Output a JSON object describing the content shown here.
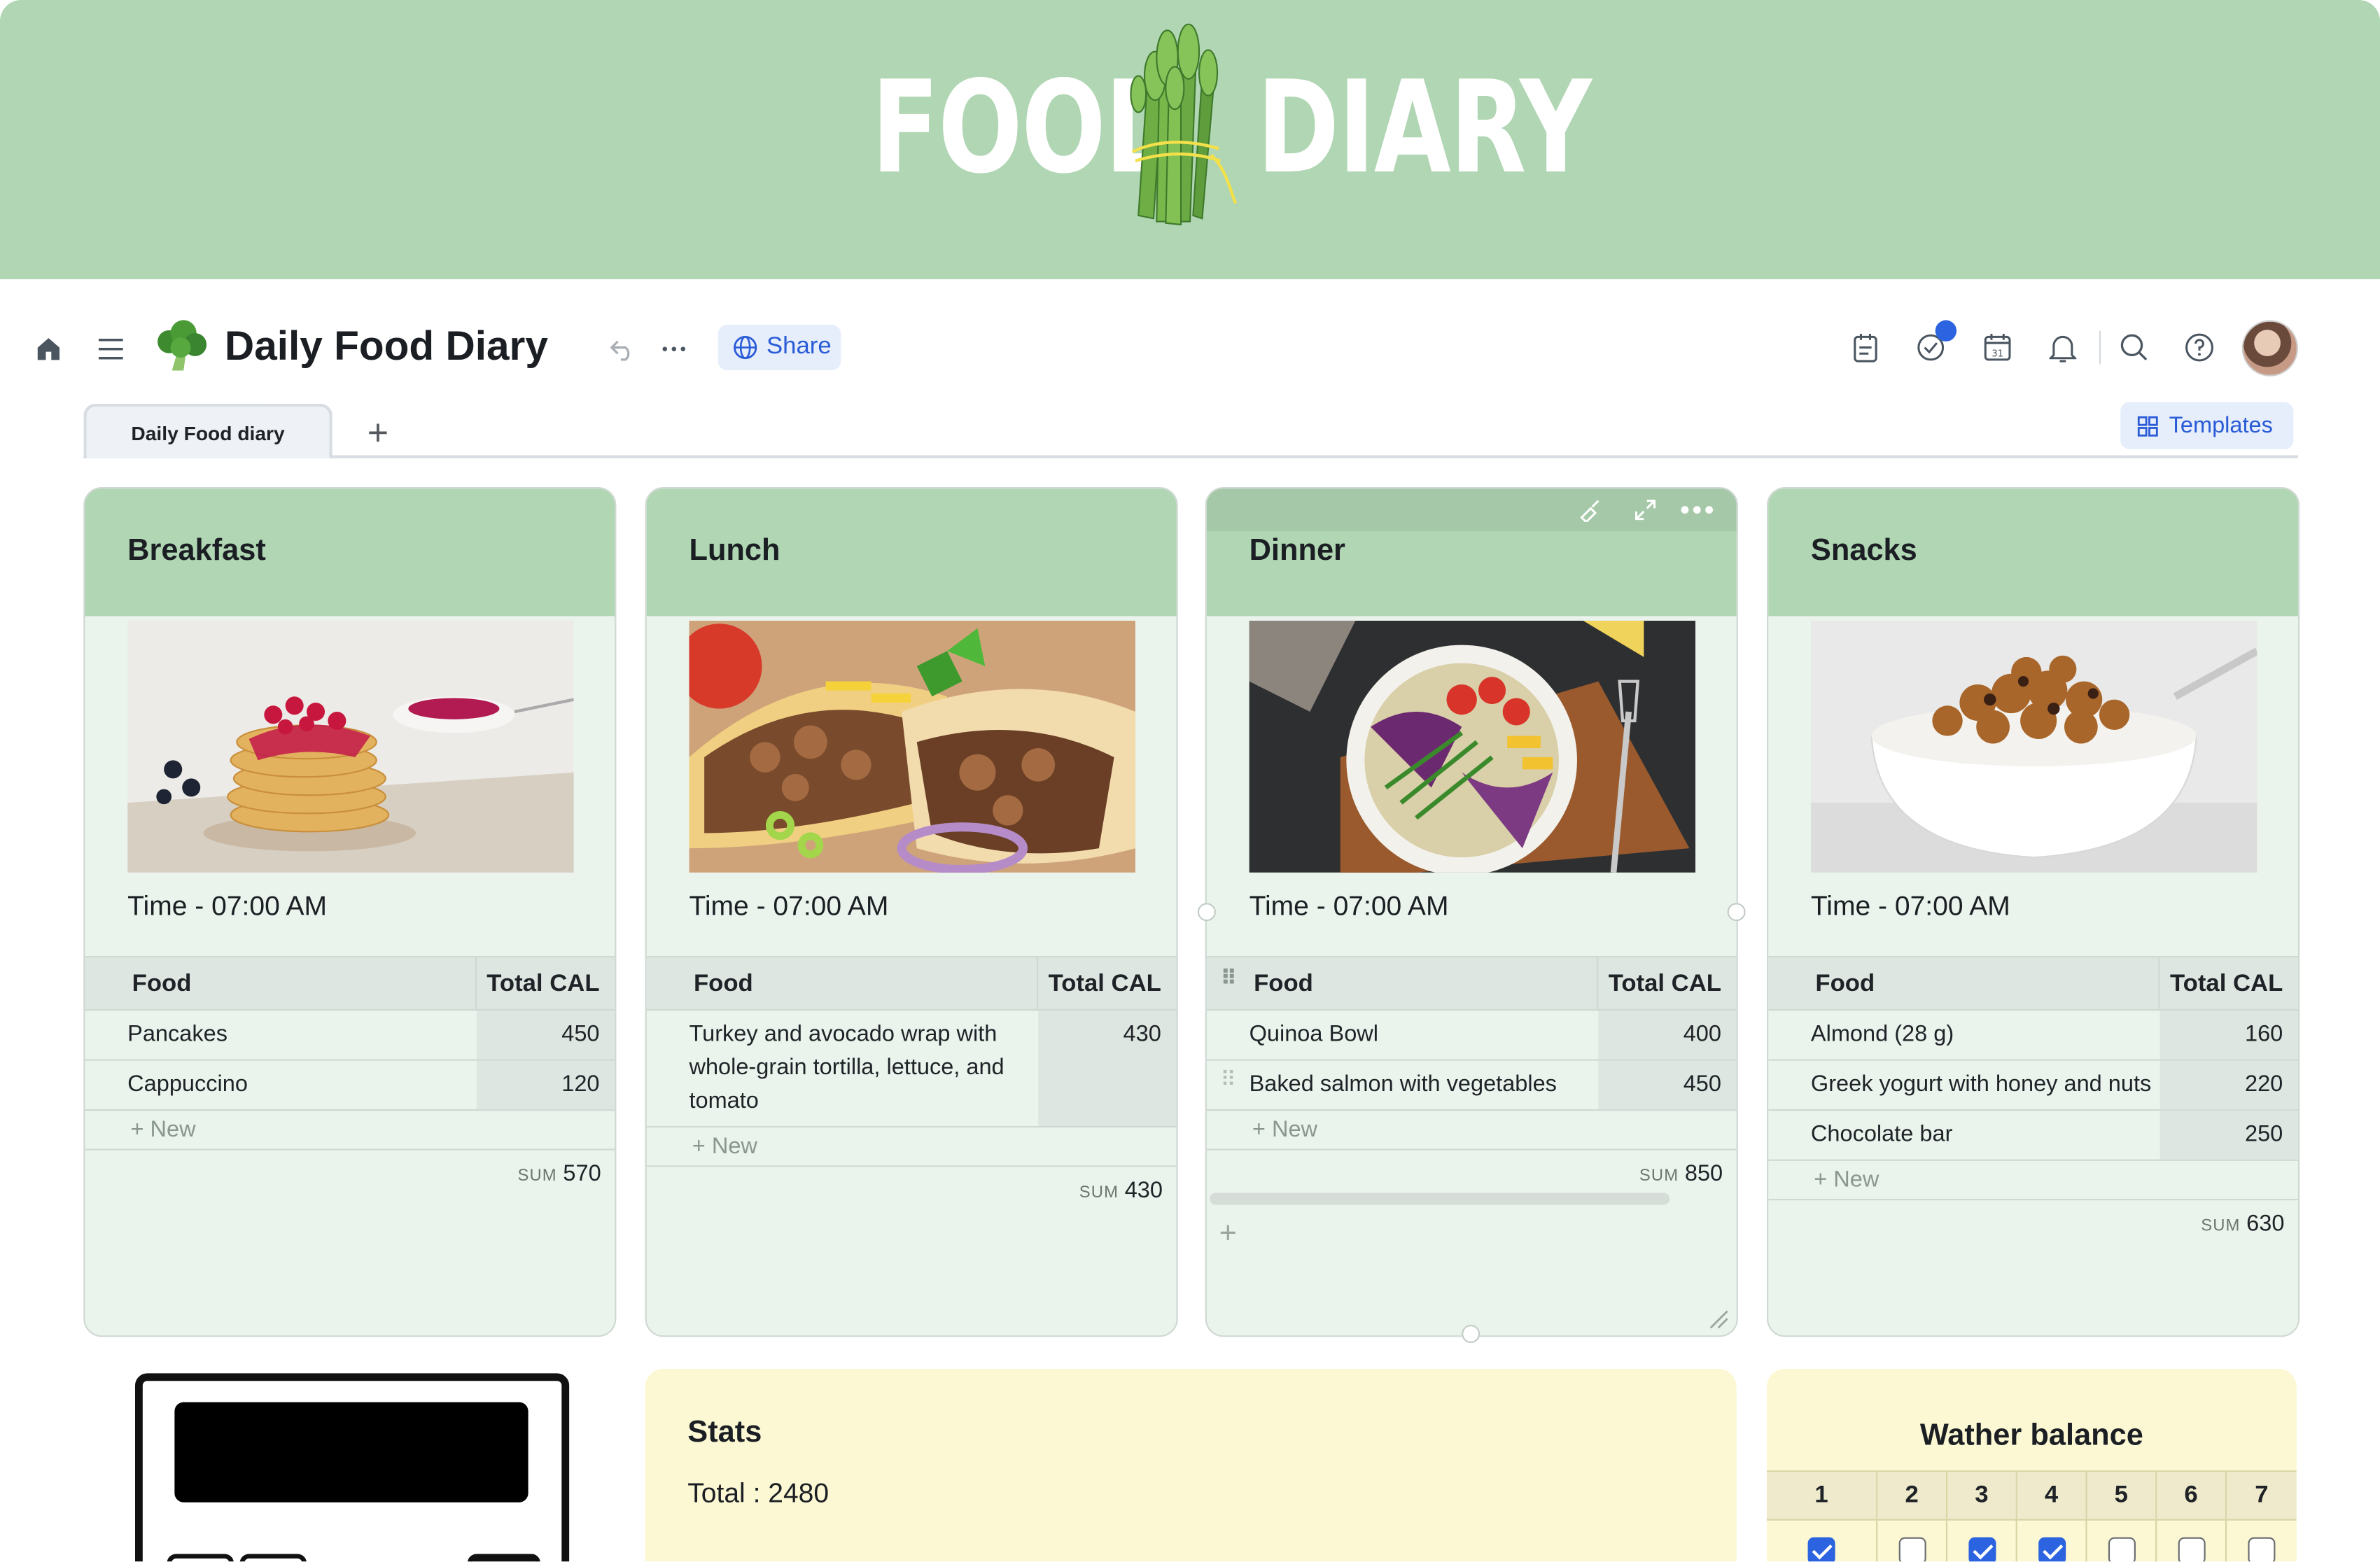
{
  "banner": {
    "word_left": "FOOD",
    "word_right": "DIARY"
  },
  "header": {
    "title": "Daily Food Diary",
    "share_label": "Share",
    "page_icon": "broccoli-icon"
  },
  "tabs": [
    {
      "label": "Daily Food diary"
    }
  ],
  "templates_label": "Templates",
  "meals": [
    {
      "title": "Breakfast",
      "time": "Time - 07:00 AM",
      "col_food": "Food",
      "col_cal": "Total CAL",
      "rows": [
        {
          "food": "Pancakes",
          "cal": "450"
        },
        {
          "food": "Cappuccino",
          "cal": "120"
        }
      ],
      "new_label": "New",
      "sum_label": "SUM",
      "sum": "570"
    },
    {
      "title": "Lunch",
      "time": "Time - 07:00 AM",
      "col_food": "Food",
      "col_cal": "Total CAL",
      "rows": [
        {
          "food": "Turkey and avocado wrap with whole-grain tortilla, lettuce, and tomato",
          "cal": "430"
        }
      ],
      "new_label": "New",
      "sum_label": "SUM",
      "sum": "430"
    },
    {
      "title": "Dinner",
      "time": "Time - 07:00 AM",
      "col_food": "Food",
      "col_cal": "Total CAL",
      "rows": [
        {
          "food": "Quinoa Bowl",
          "cal": "400"
        },
        {
          "food": "Baked salmon with vegetables",
          "cal": "450"
        }
      ],
      "new_label": "New",
      "sum_label": "SUM",
      "sum": "850"
    },
    {
      "title": "Snacks",
      "time": "Time - 07:00 AM",
      "col_food": "Food",
      "col_cal": "Total CAL",
      "rows": [
        {
          "food": "Almond (28 g)",
          "cal": "160"
        },
        {
          "food": "Greek yogurt with honey and nuts",
          "cal": "220"
        },
        {
          "food": "Chocolate bar",
          "cal": "250"
        }
      ],
      "new_label": "New",
      "sum_label": "SUM",
      "sum": "630"
    }
  ],
  "stats": {
    "title": "Stats",
    "total": "Total : 2480"
  },
  "water": {
    "title": "Wather balance",
    "days": [
      "1",
      "2",
      "3",
      "4",
      "5",
      "6",
      "7"
    ],
    "checked": [
      true,
      false,
      true,
      true,
      false,
      false,
      false
    ]
  },
  "colors": {
    "banner": "#b0d6b3",
    "card_bg": "#eaf4ec",
    "accent": "#2b63e0",
    "note_bg": "#fcf8d3"
  }
}
